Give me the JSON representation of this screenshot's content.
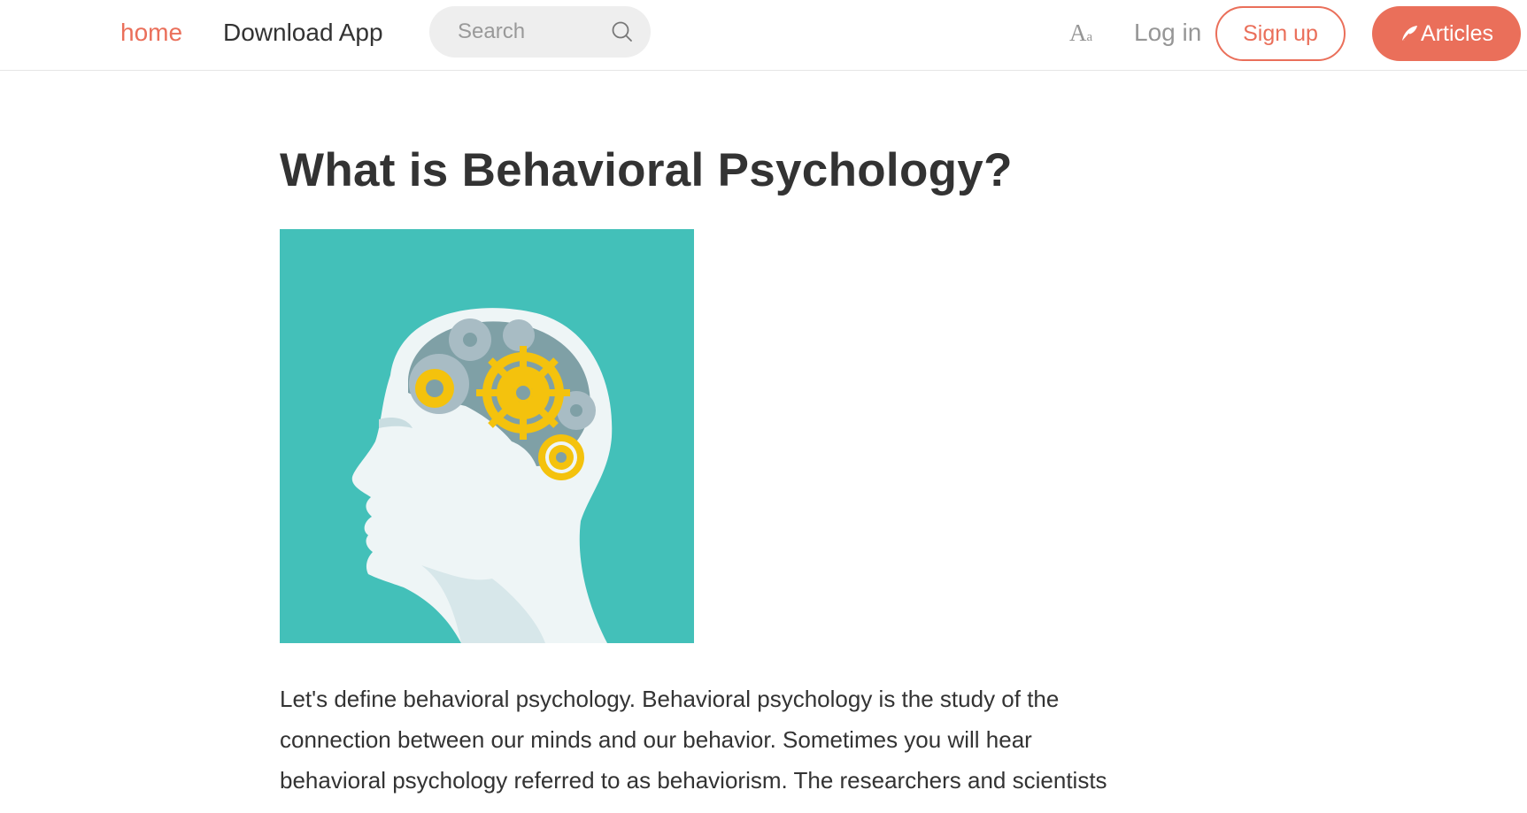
{
  "nav": {
    "home_label": "home",
    "download_label": "Download App",
    "search_placeholder": "Search",
    "font_toggle_big": "A",
    "font_toggle_small": "a",
    "login_label": "Log in",
    "signup_label": "Sign up",
    "articles_label": "Articles",
    "icons": {
      "search": "search-icon",
      "font": "font-size-icon",
      "feather": "feather-icon"
    }
  },
  "article": {
    "title": "What is Behavioral Psychology?",
    "image_alt": "head-with-gears-illustration",
    "body": "Let's define behavioral psychology. Behavioral psychology is the study of the connection between our minds and our behavior. Sometimes you will hear behavioral psychology referred to as behaviorism. The researchers and scientists"
  },
  "colors": {
    "accent": "#ea6f5a",
    "image_background": "#43c0b9",
    "gear_yellow": "#f4c20d",
    "text": "#333333",
    "muted": "#969696"
  }
}
